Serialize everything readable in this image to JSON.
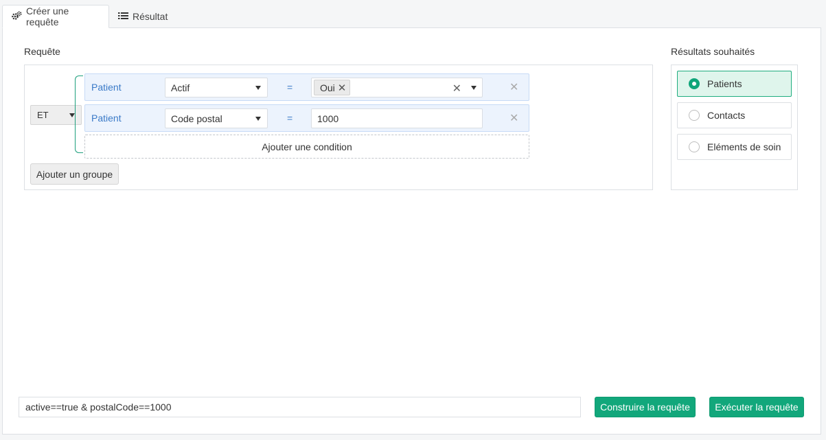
{
  "tabs": [
    {
      "label": "Créer une requête",
      "icon": "gears-icon",
      "active": true
    },
    {
      "label": "Résultat",
      "icon": "list-icon",
      "active": false
    }
  ],
  "query": {
    "section_label": "Requête",
    "group_operator": "ET",
    "conditions": [
      {
        "entity": "Patient",
        "field": "Actif",
        "operator": "=",
        "value_chips": [
          "Oui"
        ]
      },
      {
        "entity": "Patient",
        "field": "Code postal",
        "operator": "=",
        "value": "1000"
      }
    ],
    "add_condition_label": "Ajouter une condition",
    "add_group_label": "Ajouter un groupe"
  },
  "results": {
    "section_label": "Résultats souhaités",
    "options": [
      {
        "label": "Patients",
        "selected": true
      },
      {
        "label": "Contacts",
        "selected": false
      },
      {
        "label": "Eléments de soin",
        "selected": false
      }
    ]
  },
  "footer": {
    "query_string": "active==true & postalCode==1000",
    "build_label": "Construire la requête",
    "run_label": "Exécuter la requête"
  },
  "colors": {
    "accent": "#12a77b",
    "entity_text": "#3a7ac8",
    "condition_bg": "#ecf3fd",
    "selected_bg": "#dff5ec"
  }
}
